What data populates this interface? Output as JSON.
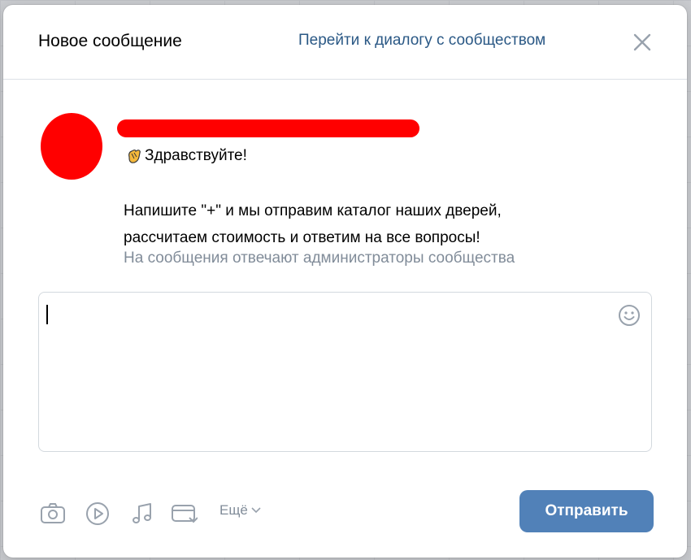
{
  "header": {
    "title": "Новое сообщение",
    "goto_link": "Перейти к диалогу с сообществом",
    "close_icon": "close-icon"
  },
  "message": {
    "greeting_icon": "waving-hand-icon",
    "greeting": "Здравствуйте!",
    "line1": "Напишите \"+\" и мы отправим каталог наших дверей,",
    "line2": "рассчитаем стоимость и ответим на все вопросы!",
    "admin_note": "На сообщения отвечают администраторы сообщества"
  },
  "composer": {
    "value": "",
    "emoji_icon": "smile-icon"
  },
  "toolbar": {
    "icons": [
      "camera-icon",
      "video-icon",
      "music-icon",
      "card-icon"
    ],
    "more_label": "Ещё",
    "send_label": "Отправить"
  },
  "colors": {
    "link": "#2a5885",
    "muted": "#818c99",
    "accent": "#5181b8",
    "redacted": "#ff0000"
  }
}
